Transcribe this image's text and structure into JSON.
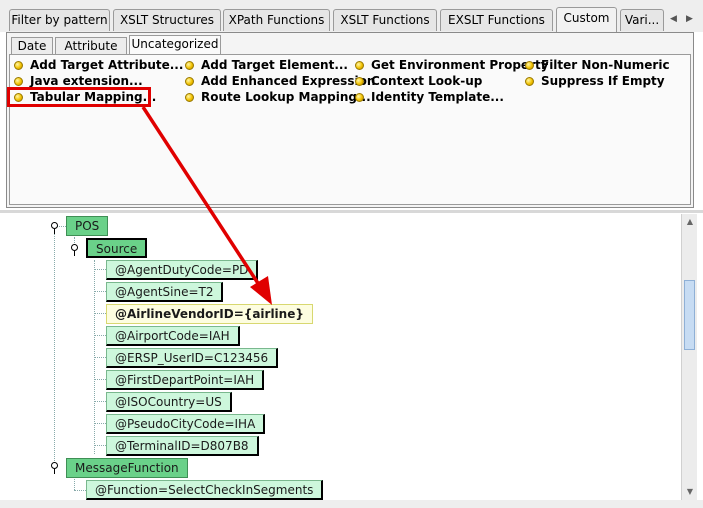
{
  "top_tabs": [
    {
      "label": "Filter by pattern",
      "active": false
    },
    {
      "label": "XSLT Structures",
      "active": false
    },
    {
      "label": "XPath Functions",
      "active": false
    },
    {
      "label": "XSLT Functions",
      "active": false
    },
    {
      "label": "EXSLT Functions",
      "active": false
    },
    {
      "label": "Custom",
      "active": true
    },
    {
      "label": "Vari...",
      "active": false
    }
  ],
  "tab_scroll": {
    "left_icon": "chevron-left-icon",
    "right_icon": "chevron-right-icon"
  },
  "sub_tabs": [
    {
      "label": "Date",
      "active": false
    },
    {
      "label": "Attribute",
      "active": false
    },
    {
      "label": "Uncategorized",
      "active": true
    }
  ],
  "palette_items": {
    "col1": [
      "Add Target Attribute...",
      "Java extension...",
      "Tabular Mapping..."
    ],
    "col2": [
      "Add Target Element...",
      "Add Enhanced Expression",
      "Route Lookup Mapping..."
    ],
    "col3": [
      "Get Environment Property",
      "Context Look-up",
      "Identity Template..."
    ],
    "col4": [
      "Filter Non-Numeric",
      "Suppress If Empty"
    ]
  },
  "highlighted_item": "Tabular Mapping...",
  "annotation_color": "#e00000",
  "tree": {
    "pos": "POS",
    "source": "Source",
    "attributes": [
      "@AgentDutyCode=PD",
      "@AgentSine=T2",
      "@AirlineVendorID={airline}",
      "@AirportCode=IAH",
      "@ERSP_UserID=C123456",
      "@FirstDepartPoint=IAH",
      "@ISOCountry=US",
      "@PseudoCityCode=IHA",
      "@TerminalID=D807B8"
    ],
    "message_function": "MessageFunction",
    "function_attr": "@Function=SelectCheckInSegments"
  },
  "colors": {
    "element_green": "#6ad189",
    "attribute_green": "#cdf7dc",
    "highlight_yellow": "#fdfde0"
  }
}
